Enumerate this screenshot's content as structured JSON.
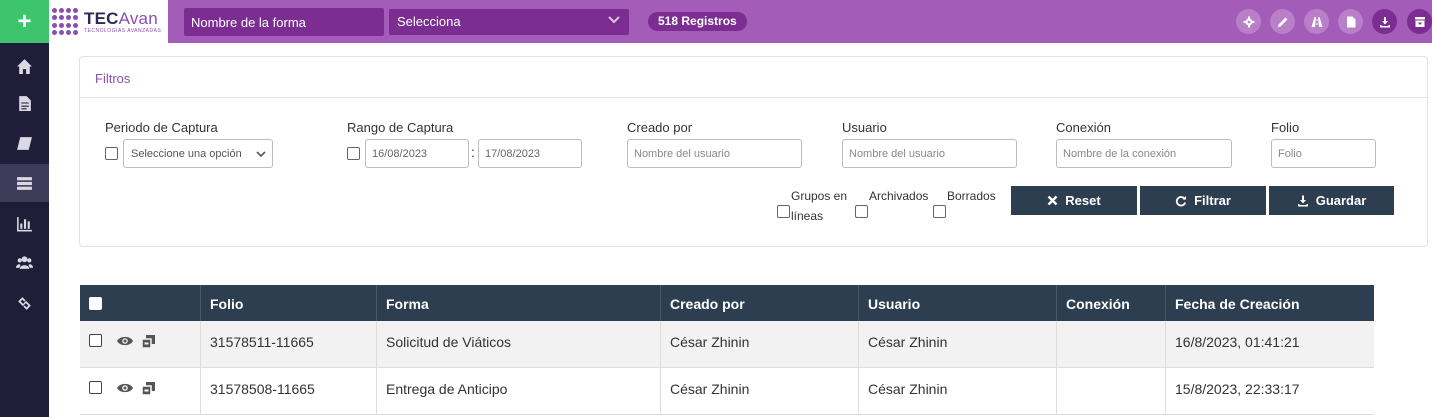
{
  "topbar": {
    "logo_main": "TEC",
    "logo_accent": "Avan",
    "logo_sub": "TECNOLOGÍAS AVANZADAS",
    "form_name": "Nombre de la forma",
    "form_select": "Selecciona",
    "records": "518 Registros",
    "icons": [
      "gear-icon",
      "pencil-icon",
      "road-icon",
      "file-icon",
      "download-icon",
      "archive-icon"
    ],
    "color": "#a35cb8",
    "accent_dark": "#7b2d91"
  },
  "sidebar": {
    "add_label": "+",
    "items": [
      "home-icon",
      "document-icon",
      "book-icon",
      "list-icon",
      "bar-chart-icon",
      "users-icon",
      "link-icon"
    ],
    "active_index": 3,
    "color": "#1f1d38",
    "add_color": "#3ec46d"
  },
  "filters": {
    "title": "Filtros",
    "periodo_label": "Periodo de Captura",
    "periodo_select": "Seleccione una opción",
    "rango_label": "Rango de Captura",
    "rango_from": "16/08/2023",
    "rango_sep": ":",
    "rango_to": "17/08/2023",
    "creado_label": "Creado por",
    "creado_placeholder": "Nombre del usuario",
    "usuario_label": "Usuario",
    "usuario_placeholder": "Nombre del usuario",
    "conexion_label": "Conexión",
    "conexion_placeholder": "Nombre de la conexión",
    "folio_label": "Folio",
    "folio_placeholder": "Folio",
    "grupos_label_1": "Grupos en",
    "grupos_label_2": "líneas",
    "archivados_label": "Archivados",
    "borrados_label": "Borrados",
    "reset_label": "Reset",
    "filtrar_label": "Filtrar",
    "guardar_label": "Guardar"
  },
  "table": {
    "headers": [
      "Folio",
      "Forma",
      "Creado por",
      "Usuario",
      "Conexión",
      "Fecha de Creación"
    ],
    "rows": [
      {
        "folio": "31578511-11665",
        "forma": "Solicitud de Viáticos",
        "creado": "César Zhinin",
        "usuario": "César Zhinin",
        "conexion": "",
        "fecha": "16/8/2023, 01:41:21"
      },
      {
        "folio": "31578508-11665",
        "forma": "Entrega de Anticipo",
        "creado": "César Zhinin",
        "usuario": "César Zhinin",
        "conexion": "",
        "fecha": "15/8/2023, 22:33:17"
      }
    ],
    "header_color": "#2d3e50"
  }
}
